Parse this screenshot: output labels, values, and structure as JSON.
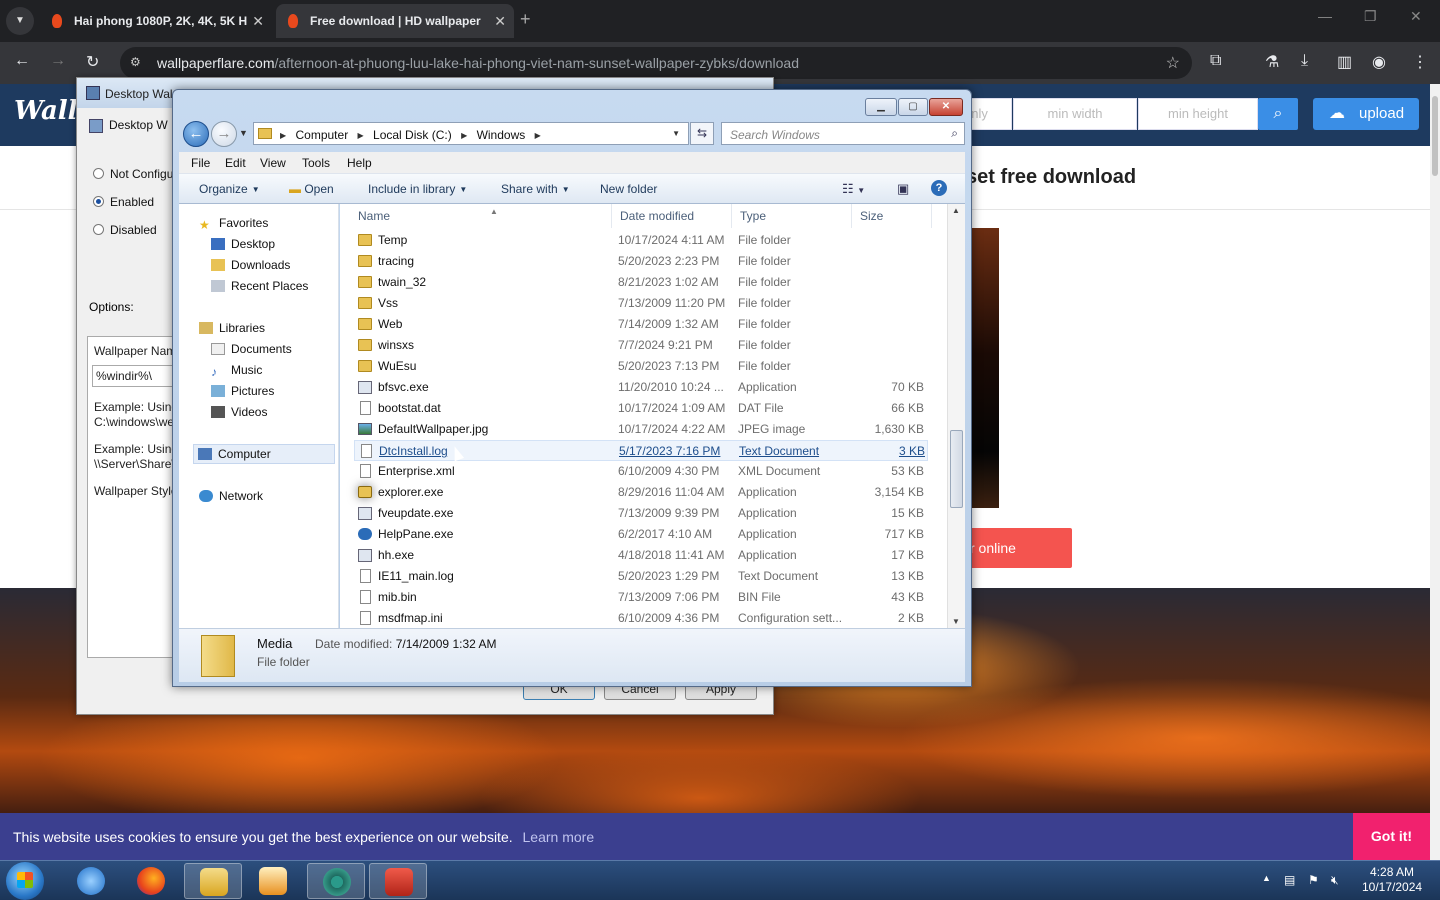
{
  "browser": {
    "tabs": [
      {
        "title": "Hai phong 1080P, 2K, 4K, 5K H",
        "close": "✕"
      },
      {
        "title": "Free download | HD wallpaper",
        "close": "✕"
      }
    ],
    "url_host": "wallpaperflare.com",
    "url_path": "/afternoon-at-phuong-luu-lake-hai-phong-viet-nam-sunset-wallpaper-zybks/download"
  },
  "site": {
    "logo": "Wallp",
    "only_input": "only",
    "min_width": "min width",
    "min_height": "min height",
    "upload_label": "upload",
    "page_title": "set free download",
    "red_button": "r online"
  },
  "cookie": {
    "message": "This website uses cookies to ensure you get the best experience on our website.",
    "learn_more": "Learn more",
    "got_it": "Got it!"
  },
  "policy_dialog": {
    "title": "Desktop Wal",
    "subtitle": "Desktop W",
    "radios": [
      {
        "label": "Not Configu",
        "checked": false
      },
      {
        "label": "Enabled",
        "checked": true
      },
      {
        "label": "Disabled",
        "checked": false
      }
    ],
    "options_label": "Options:",
    "wallpaper_name_label": "Wallpaper Nam",
    "wallpaper_name_value": "%windir%\\",
    "example1_line1": "Example: Using",
    "example1_line2": "C:\\windows\\we",
    "example2_line1": "Example: Using",
    "example2_line2": "\\\\Server\\Share\\",
    "wallpaper_style_label": "Wallpaper Style",
    "ok": "OK",
    "cancel": "Cancel",
    "apply": "Apply"
  },
  "explorer": {
    "breadcrumbs": [
      "Computer",
      "Local Disk (C:)",
      "Windows"
    ],
    "search_placeholder": "Search Windows",
    "menu": [
      "File",
      "Edit",
      "View",
      "Tools",
      "Help"
    ],
    "commands": {
      "organize": "Organize",
      "open": "Open",
      "include": "Include in library",
      "share": "Share with",
      "new_folder": "New folder"
    },
    "nav": {
      "favorites": "Favorites",
      "desktop": "Desktop",
      "downloads": "Downloads",
      "recent": "Recent Places",
      "libraries": "Libraries",
      "documents": "Documents",
      "music": "Music",
      "pictures": "Pictures",
      "videos": "Videos",
      "computer": "Computer",
      "network": "Network"
    },
    "columns": {
      "name": "Name",
      "date": "Date modified",
      "type": "Type",
      "size": "Size"
    },
    "files": [
      {
        "name": "Temp",
        "date": "10/17/2024 4:11 AM",
        "type": "File folder",
        "size": "",
        "icon": "folder"
      },
      {
        "name": "tracing",
        "date": "5/20/2023 2:23 PM",
        "type": "File folder",
        "size": "",
        "icon": "folder"
      },
      {
        "name": "twain_32",
        "date": "8/21/2023 1:02 AM",
        "type": "File folder",
        "size": "",
        "icon": "folder"
      },
      {
        "name": "Vss",
        "date": "7/13/2009 11:20 PM",
        "type": "File folder",
        "size": "",
        "icon": "folder"
      },
      {
        "name": "Web",
        "date": "7/14/2009 1:32 AM",
        "type": "File folder",
        "size": "",
        "icon": "folder"
      },
      {
        "name": "winsxs",
        "date": "7/7/2024 9:21 PM",
        "type": "File folder",
        "size": "",
        "icon": "folder"
      },
      {
        "name": "WuEsu",
        "date": "5/20/2023 7:13 PM",
        "type": "File folder",
        "size": "",
        "icon": "folder"
      },
      {
        "name": "bfsvc.exe",
        "date": "11/20/2010 10:24 ...",
        "type": "Application",
        "size": "70 KB",
        "icon": "app"
      },
      {
        "name": "bootstat.dat",
        "date": "10/17/2024 1:09 AM",
        "type": "DAT File",
        "size": "66 KB",
        "icon": "doc"
      },
      {
        "name": "DefaultWallpaper.jpg",
        "date": "10/17/2024 4:22 AM",
        "type": "JPEG image",
        "size": "1,630 KB",
        "icon": "img"
      },
      {
        "name": "DtcInstall.log",
        "date": "5/17/2023 7:16 PM",
        "type": "Text Document",
        "size": "3 KB",
        "icon": "doc"
      },
      {
        "name": "Enterprise.xml",
        "date": "6/10/2009 4:30 PM",
        "type": "XML Document",
        "size": "53 KB",
        "icon": "doc"
      },
      {
        "name": "explorer.exe",
        "date": "8/29/2016 11:04 AM",
        "type": "Application",
        "size": "3,154 KB",
        "icon": "explorer"
      },
      {
        "name": "fveupdate.exe",
        "date": "7/13/2009 9:39 PM",
        "type": "Application",
        "size": "15 KB",
        "icon": "app"
      },
      {
        "name": "HelpPane.exe",
        "date": "6/2/2017 4:10 AM",
        "type": "Application",
        "size": "717 KB",
        "icon": "help"
      },
      {
        "name": "hh.exe",
        "date": "4/18/2018 11:41 AM",
        "type": "Application",
        "size": "17 KB",
        "icon": "app"
      },
      {
        "name": "IE11_main.log",
        "date": "5/20/2023 1:29 PM",
        "type": "Text Document",
        "size": "13 KB",
        "icon": "doc"
      },
      {
        "name": "mib.bin",
        "date": "7/13/2009 7:06 PM",
        "type": "BIN File",
        "size": "43 KB",
        "icon": "doc"
      },
      {
        "name": "msdfmap.ini",
        "date": "6/10/2009 4:36 PM",
        "type": "Configuration sett...",
        "size": "2 KB",
        "icon": "doc"
      }
    ],
    "hovered_file": "DtcInstall.log",
    "details": {
      "name": "Media",
      "date_label": "Date modified:",
      "date_value": "7/14/2009 1:32 AM",
      "type": "File folder"
    }
  },
  "taskbar": {
    "time": "4:28 AM",
    "date": "10/17/2024"
  }
}
